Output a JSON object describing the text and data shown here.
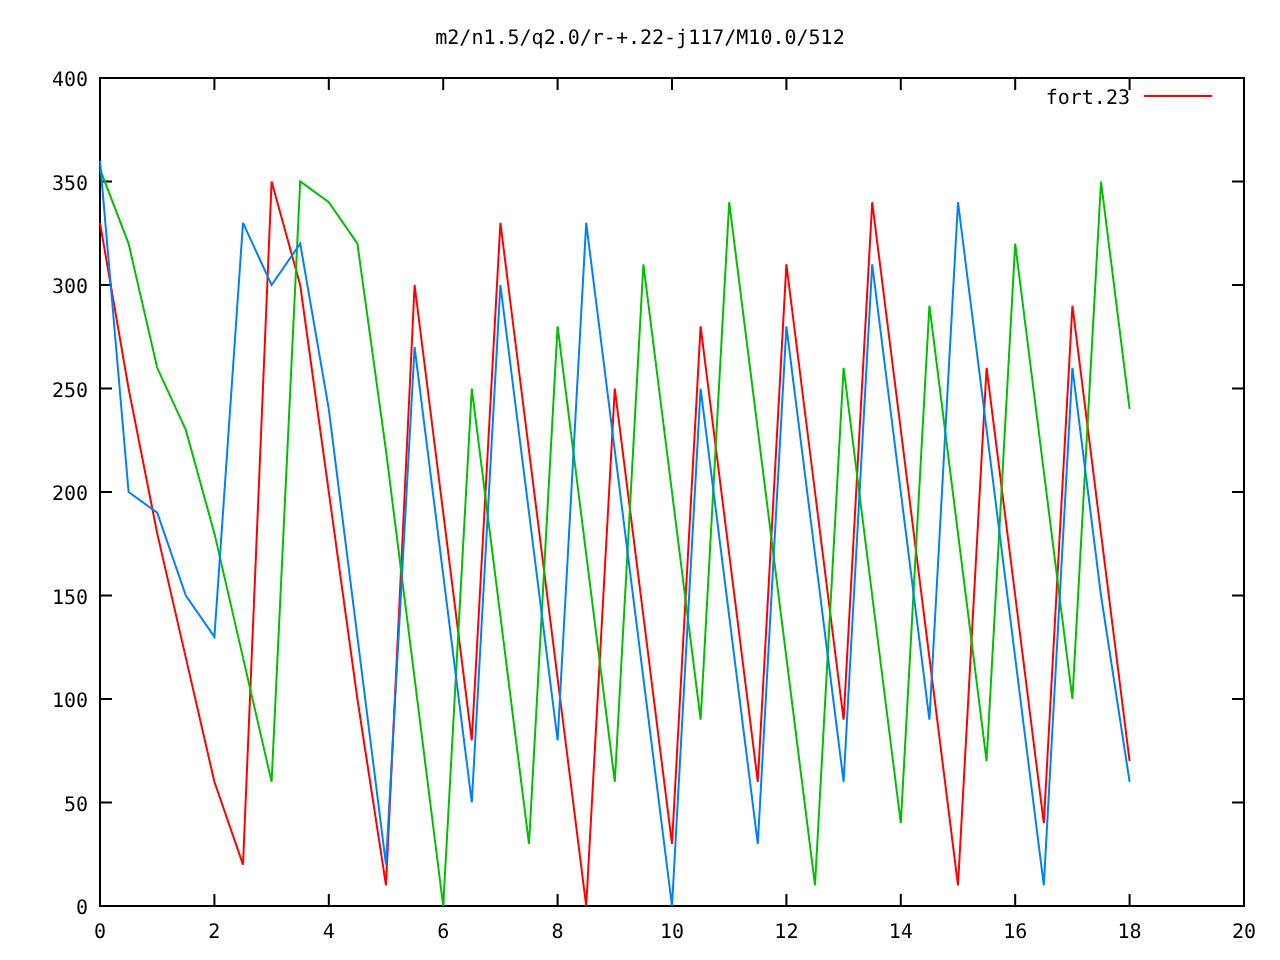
{
  "chart_data": {
    "type": "line",
    "title": "m2/n1.5/q2.0/r-+.22-j117/M10.0/512",
    "x": [
      0,
      0.5,
      1,
      1.5,
      2,
      2.5,
      3,
      3.5,
      4,
      4.5,
      5,
      5.5,
      6,
      6.5,
      7,
      7.5,
      8,
      8.5,
      9,
      9.5,
      10,
      10.5,
      11,
      11.5,
      12,
      12.5,
      13,
      13.5,
      14,
      14.5,
      15,
      15.5,
      16,
      16.5,
      17,
      17.5,
      18
    ],
    "series": [
      {
        "name": "fort.23",
        "color": "#ff0000",
        "values": [
          330,
          250,
          180,
          120,
          60,
          20,
          350,
          300,
          200,
          100,
          10,
          300,
          190,
          80,
          330,
          220,
          110,
          0,
          250,
          140,
          30,
          280,
          170,
          60,
          310,
          200,
          90,
          340,
          230,
          120,
          10,
          260,
          150,
          40,
          290,
          180,
          70
        ]
      },
      {
        "color": "#00c000",
        "values": [
          356,
          320,
          260,
          230,
          180,
          120,
          60,
          350,
          340,
          320,
          220,
          110,
          0,
          250,
          140,
          30,
          280,
          170,
          60,
          310,
          200,
          90,
          340,
          230,
          120,
          10,
          260,
          150,
          40,
          290,
          180,
          70,
          320,
          210,
          100,
          350,
          240
        ]
      },
      {
        "color": "#0080ff",
        "values": [
          360,
          200,
          190,
          150,
          130,
          330,
          300,
          320,
          240,
          130,
          20,
          270,
          160,
          50,
          300,
          190,
          80,
          330,
          220,
          110,
          0,
          250,
          140,
          30,
          280,
          170,
          60,
          310,
          200,
          90,
          340,
          230,
          120,
          10,
          260,
          150,
          60
        ]
      }
    ],
    "xlim": [
      0,
      20
    ],
    "ylim": [
      0,
      400
    ],
    "xticks": [
      0,
      2,
      4,
      6,
      8,
      10,
      12,
      14,
      16,
      18,
      20
    ],
    "yticks": [
      0,
      50,
      100,
      150,
      200,
      250,
      300,
      350,
      400
    ]
  }
}
